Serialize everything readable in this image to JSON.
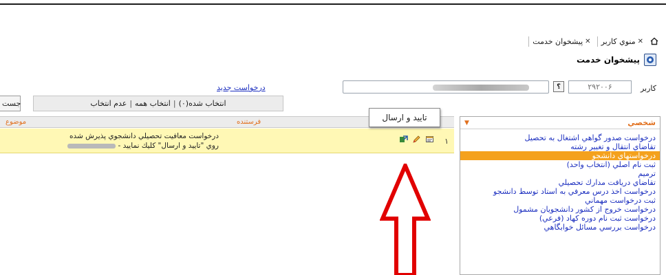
{
  "breadcrumb": {
    "items": [
      "منوي كاربر",
      "پيشخوان خدمت"
    ],
    "close_glyph": "✕"
  },
  "page_title": "پيشخوان خدمت",
  "user": {
    "label": "كاربر",
    "id_value": "۲۹۲۰۰۶",
    "help_glyph": "؟"
  },
  "links": {
    "new_request": "درخواست جديد"
  },
  "selection": {
    "selected": "انتخاب شده(۰)",
    "select_all": "انتخاب همه",
    "deselect": "عدم انتخاب",
    "separator": "|"
  },
  "search_button": "جست",
  "sidebar": {
    "header": "شخصي",
    "items": [
      "درخواست صدور گواهي اشتغال به تحصيل",
      "تقاضاي انتقال و تغيير رشته",
      "درخواستهاي دانشجو",
      "ثبت نام اصلي (انتخاب واحد)",
      "ترميم",
      "تقاضاي دريافت مدارك تحصيلي",
      "درخواست اخذ درس معرفي به استاد توسط دانشجو",
      "ثبت درخواست مهماني",
      "درخواست خروج از كشور دانشجويان مشمول",
      "درخواست ثبت نام دوره كهاد (فرعي)",
      "درخواست بررسي مسائل خوابگاهي"
    ],
    "active_index": 2
  },
  "table": {
    "headers": {
      "subject": "موضوع",
      "sender": "فرستنده"
    },
    "rows": [
      {
        "num": "۱",
        "line1": "درخواست معافيت تحصيلي دانشجوي پذيرش شده",
        "line2": "روي \"تاييد و ارسال\" كليك نماييد -"
      }
    ]
  },
  "tooltip": "تاييد و ارسال",
  "colors": {
    "accent_orange": "#e1701e",
    "link_blue": "#1c2fbf",
    "row_highlight": "#fff8b5",
    "active_item": "#f4a11d",
    "arrow_red": "#e10000"
  }
}
